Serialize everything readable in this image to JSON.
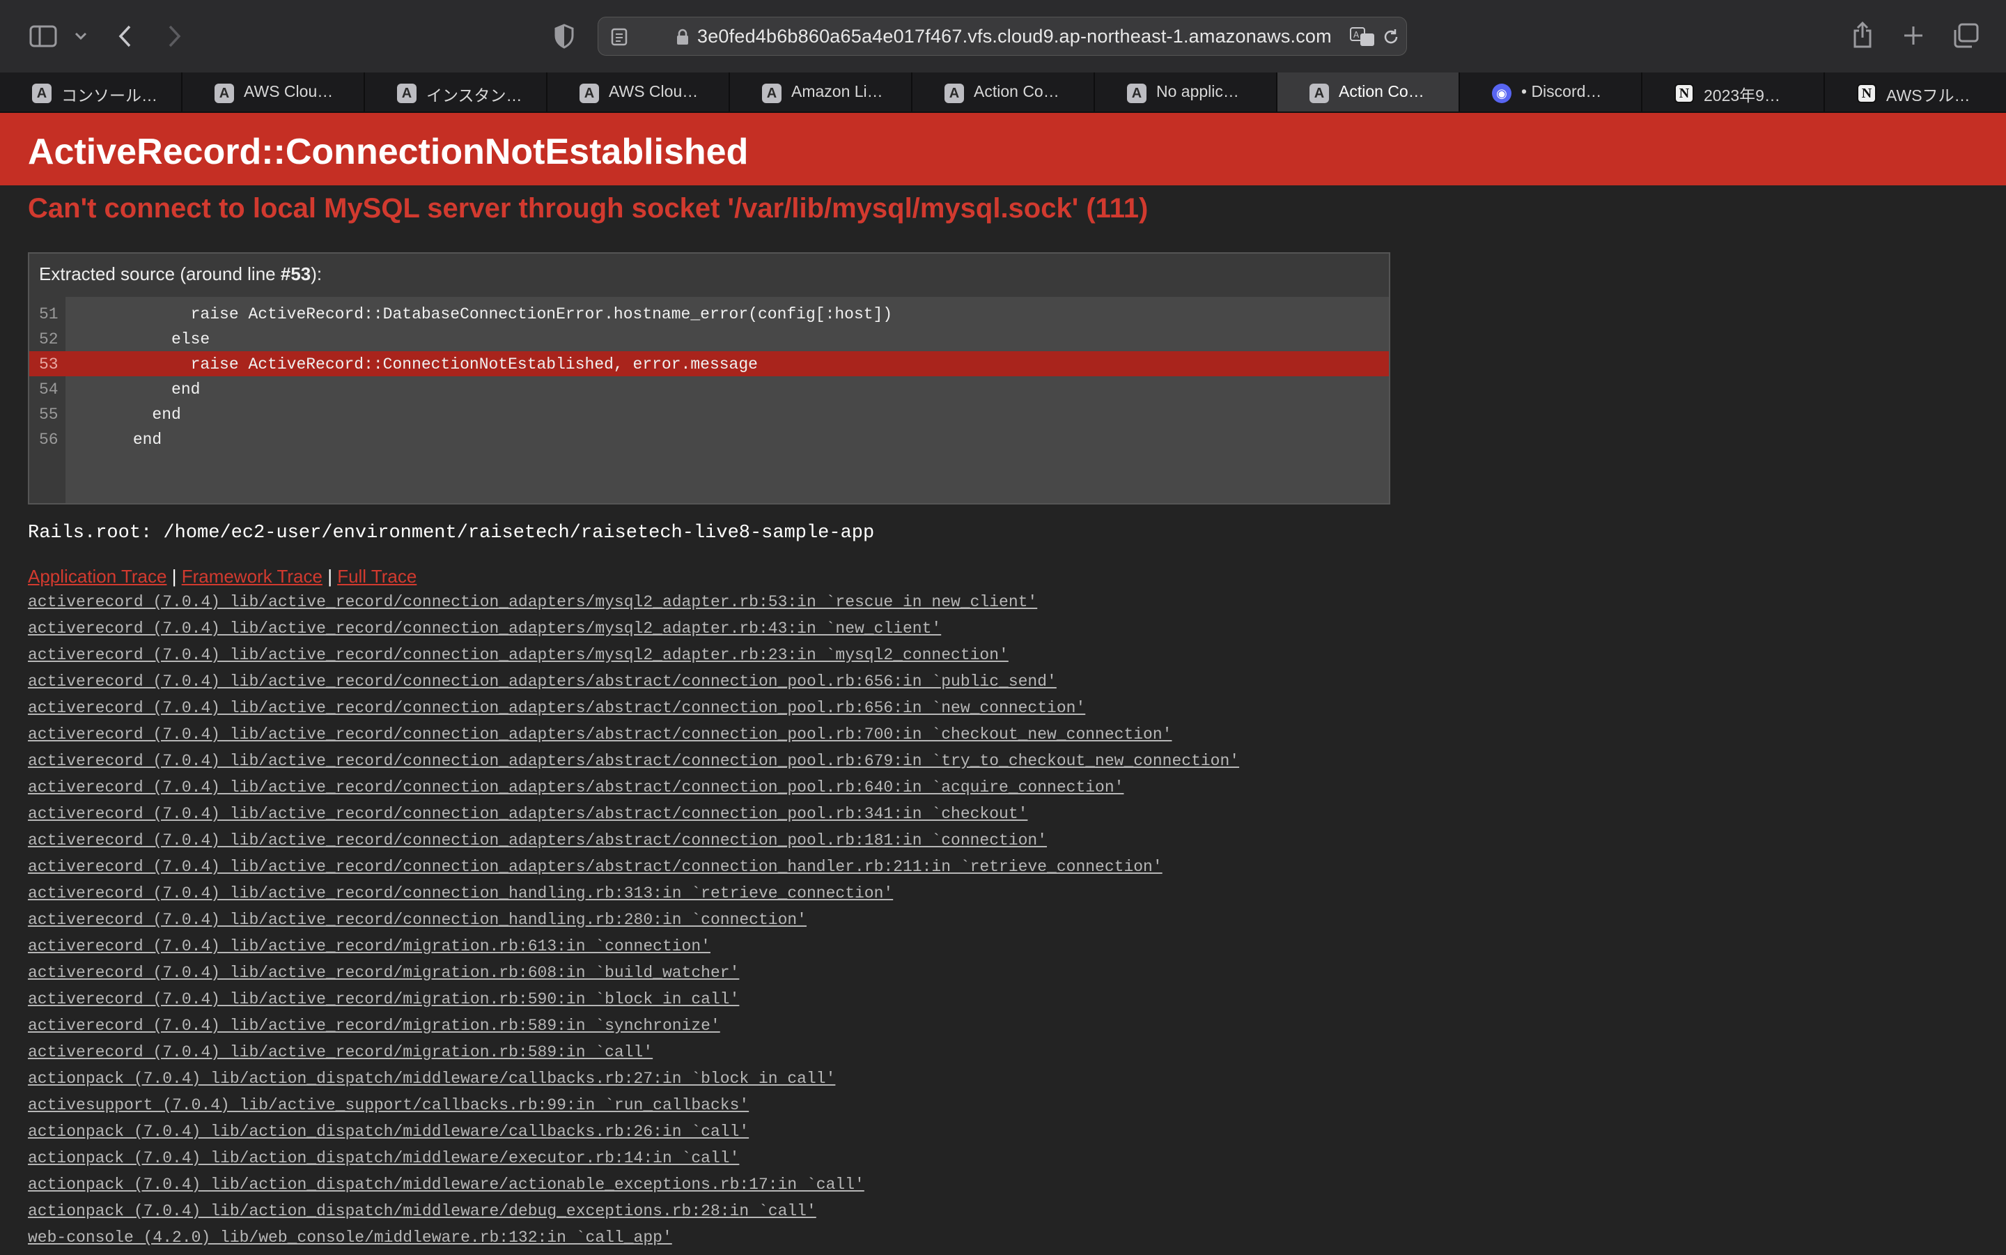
{
  "browser": {
    "url": "3e0fed4b6b860a65a4e017f467.vfs.cloud9.ap-northeast-1.amazonaws.com",
    "tabs": [
      {
        "icon": "A",
        "label": "コンソール…"
      },
      {
        "icon": "A",
        "label": "AWS Clou…"
      },
      {
        "icon": "A",
        "label": "インスタン…"
      },
      {
        "icon": "A",
        "label": "AWS Clou…"
      },
      {
        "icon": "A",
        "label": "Amazon Li…"
      },
      {
        "icon": "A",
        "label": "Action Co…"
      },
      {
        "icon": "A",
        "label": "No applic…"
      },
      {
        "icon": "A",
        "label": "Action Co…",
        "active": true
      },
      {
        "icon": "discord",
        "label": "• Discord…"
      },
      {
        "icon": "N",
        "label": "2023年9…"
      },
      {
        "icon": "N",
        "label": "AWSフル…"
      }
    ]
  },
  "error": {
    "title": "ActiveRecord::ConnectionNotEstablished",
    "message": "Can't connect to local MySQL server through socket '/var/lib/mysql/mysql.sock' (111)"
  },
  "source": {
    "title_prefix": "Extracted source (around line ",
    "title_line": "#53",
    "title_suffix": "):",
    "lines": [
      {
        "num": "51",
        "code": "            raise ActiveRecord::DatabaseConnectionError.hostname_error(config[:host])"
      },
      {
        "num": "52",
        "code": "          else"
      },
      {
        "num": "53",
        "code": "            raise ActiveRecord::ConnectionNotEstablished, error.message"
      },
      {
        "num": "54",
        "code": "          end"
      },
      {
        "num": "55",
        "code": "        end"
      },
      {
        "num": "56",
        "code": "      end"
      }
    ]
  },
  "rails_root": "Rails.root: /home/ec2-user/environment/raisetech/raisetech-live8-sample-app",
  "trace_links": {
    "application": "Application Trace",
    "framework": "Framework Trace",
    "full": "Full Trace",
    "separator": "|"
  },
  "trace": [
    "activerecord (7.0.4) lib/active_record/connection_adapters/mysql2_adapter.rb:53:in `rescue in new_client'",
    "activerecord (7.0.4) lib/active_record/connection_adapters/mysql2_adapter.rb:43:in `new_client'",
    "activerecord (7.0.4) lib/active_record/connection_adapters/mysql2_adapter.rb:23:in `mysql2_connection'",
    "activerecord (7.0.4) lib/active_record/connection_adapters/abstract/connection_pool.rb:656:in `public_send'",
    "activerecord (7.0.4) lib/active_record/connection_adapters/abstract/connection_pool.rb:656:in `new_connection'",
    "activerecord (7.0.4) lib/active_record/connection_adapters/abstract/connection_pool.rb:700:in `checkout_new_connection'",
    "activerecord (7.0.4) lib/active_record/connection_adapters/abstract/connection_pool.rb:679:in `try_to_checkout_new_connection'",
    "activerecord (7.0.4) lib/active_record/connection_adapters/abstract/connection_pool.rb:640:in `acquire_connection'",
    "activerecord (7.0.4) lib/active_record/connection_adapters/abstract/connection_pool.rb:341:in `checkout'",
    "activerecord (7.0.4) lib/active_record/connection_adapters/abstract/connection_pool.rb:181:in `connection'",
    "activerecord (7.0.4) lib/active_record/connection_adapters/abstract/connection_handler.rb:211:in `retrieve_connection'",
    "activerecord (7.0.4) lib/active_record/connection_handling.rb:313:in `retrieve_connection'",
    "activerecord (7.0.4) lib/active_record/connection_handling.rb:280:in `connection'",
    "activerecord (7.0.4) lib/active_record/migration.rb:613:in `connection'",
    "activerecord (7.0.4) lib/active_record/migration.rb:608:in `build_watcher'",
    "activerecord (7.0.4) lib/active_record/migration.rb:590:in `block in call'",
    "activerecord (7.0.4) lib/active_record/migration.rb:589:in `synchronize'",
    "activerecord (7.0.4) lib/active_record/migration.rb:589:in `call'",
    "actionpack (7.0.4) lib/action_dispatch/middleware/callbacks.rb:27:in `block in call'",
    "activesupport (7.0.4) lib/active_support/callbacks.rb:99:in `run_callbacks'",
    "actionpack (7.0.4) lib/action_dispatch/middleware/callbacks.rb:26:in `call'",
    "actionpack (7.0.4) lib/action_dispatch/middleware/executor.rb:14:in `call'",
    "actionpack (7.0.4) lib/action_dispatch/middleware/actionable_exceptions.rb:17:in `call'",
    "actionpack (7.0.4) lib/action_dispatch/middleware/debug_exceptions.rb:28:in `call'",
    "web-console (4.2.0) lib/web_console/middleware.rb:132:in `call_app'"
  ]
}
